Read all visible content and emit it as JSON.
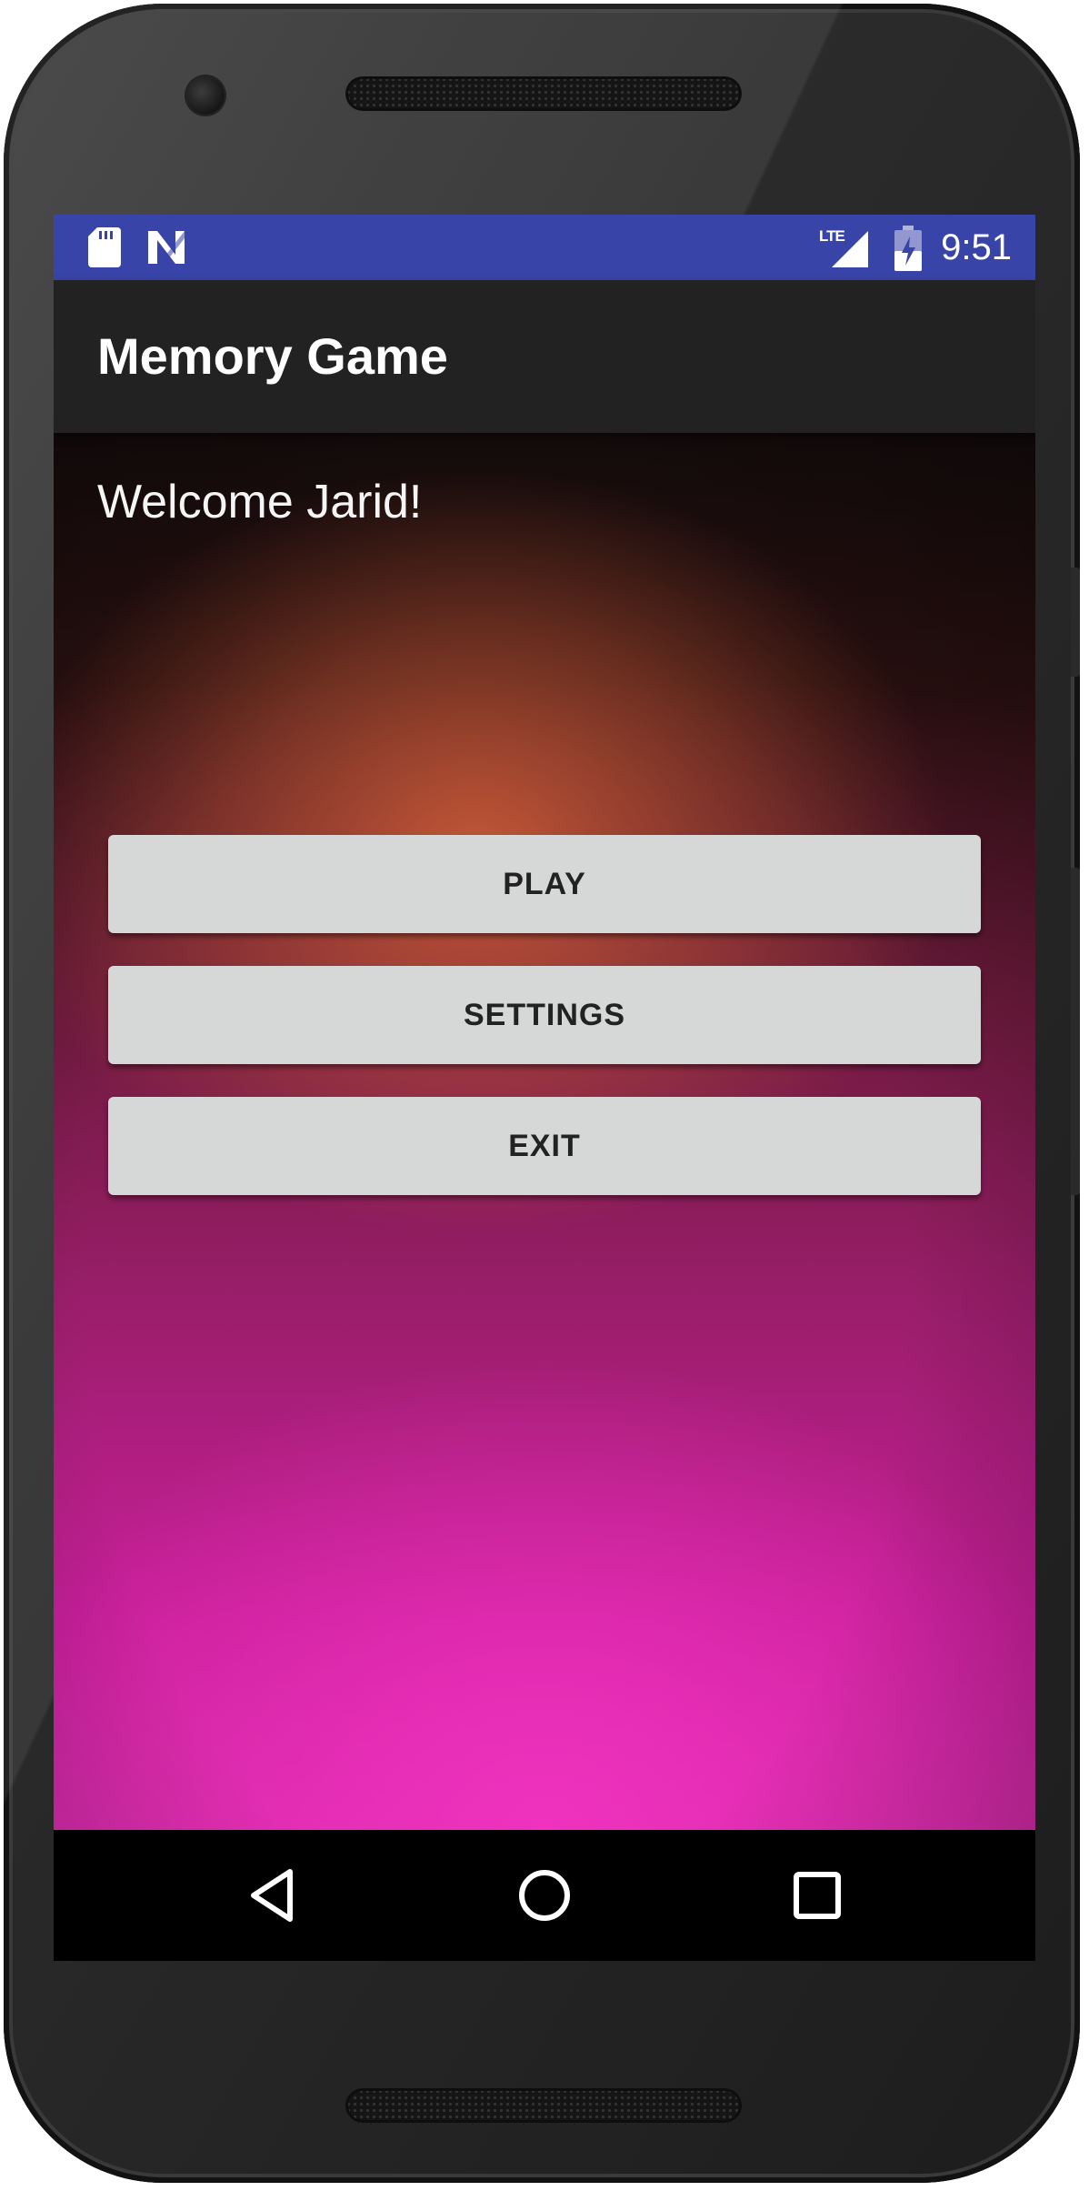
{
  "status_bar": {
    "time": "9:51",
    "network_label": "LTE",
    "background_color": "#3944a8",
    "icons": [
      "sd-card-icon",
      "n-notification-icon",
      "lte-signal-icon",
      "battery-charging-icon"
    ]
  },
  "app_bar": {
    "title": "Memory Game",
    "background_color": "#222222"
  },
  "main": {
    "welcome_text": "Welcome Jarid!",
    "buttons": {
      "play_label": "PLAY",
      "settings_label": "SETTINGS",
      "exit_label": "EXIT"
    },
    "button_color": "#d6d7d7"
  },
  "nav_bar": {
    "icons": [
      "back-icon",
      "home-icon",
      "recents-icon"
    ]
  }
}
